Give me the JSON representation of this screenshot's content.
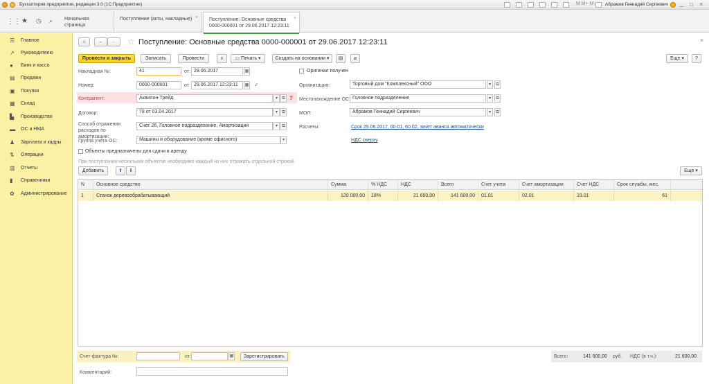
{
  "titlebar": {
    "title": "Бухгалтерия предприятия, редакция 3.0  (1С:Предприятие)",
    "user": "Абрамов Геннадий Сергеевич"
  },
  "tabs": [
    {
      "label": "Начальная страница"
    },
    {
      "label": "Поступление (акты, накладные)"
    },
    {
      "label": "Поступление: Основные средства 0000-000001 от 29.06.2017 12:23:11"
    }
  ],
  "sidebar": {
    "items": [
      {
        "label": "Главное",
        "icon": "menu-icon"
      },
      {
        "label": "Руководителю",
        "icon": "chart-line-icon"
      },
      {
        "label": "Банк и касса",
        "icon": "coin-icon"
      },
      {
        "label": "Продажи",
        "icon": "cart-icon"
      },
      {
        "label": "Покупки",
        "icon": "basket-icon"
      },
      {
        "label": "Склад",
        "icon": "warehouse-icon"
      },
      {
        "label": "Производство",
        "icon": "factory-icon"
      },
      {
        "label": "ОС и НМА",
        "icon": "truck-icon"
      },
      {
        "label": "Зарплата и кадры",
        "icon": "people-icon"
      },
      {
        "label": "Операции",
        "icon": "operations-icon"
      },
      {
        "label": "Отчеты",
        "icon": "bar-chart-icon"
      },
      {
        "label": "Справочники",
        "icon": "book-icon"
      },
      {
        "label": "Администрирование",
        "icon": "gear-icon"
      }
    ]
  },
  "doc": {
    "title": "Поступление: Основные средства 0000-000001 от 29.06.2017 12:23:11"
  },
  "toolbar": {
    "post_close": "Провести и закрыть",
    "save": "Записать",
    "post": "Провести",
    "print": "Печать",
    "create_based": "Создать на основании",
    "more": "Еще",
    "help": "?"
  },
  "form": {
    "invoice_label": "Накладная №:",
    "invoice_no": "41",
    "invoice_date_label": "от:",
    "invoice_date": "29.06.2017",
    "number_label": "Номер:",
    "number": "0000-000001",
    "number_date_label": "от:",
    "number_date": "29.06.2017 12:23:11",
    "original_label": "Оригинал получен",
    "org_label": "Организация:",
    "org": "Торговый дом \"Комплексный\" ООО",
    "counterparty_label": "Контрагент:",
    "counterparty": "Аквилон-Трейд",
    "location_label": "Местонахождение ОС:",
    "location": "Головное подразделение",
    "contract_label": "Договор:",
    "contract": "78 от 03.04.2017",
    "mol_label": "МОЛ:",
    "mol": "Абрамов Геннадий Сергеевич",
    "amort_label": "Способ отражения расходов по амортизации:",
    "amort": "Счет 26, Головное подразделение, Амортизация",
    "settlements_label": "Расчеты:",
    "settlements_link": "Срок 29.06.2017, 60.01, 60.02, зачет аванса автоматически",
    "group_label": "Группа учета ОС:",
    "group": "Машины и оборудование (кроме офисного)",
    "vat_link": "НДС сверху",
    "rent_label": "Объекты предназначены для сдачи в аренду",
    "hint": "При поступлении нескольких объектов необходимо каждый из них отражать отдельной строкой"
  },
  "table": {
    "add": "Добавить",
    "more": "Еще",
    "headers": [
      "N",
      "Основное средство",
      "Сумма",
      "% НДС",
      "НДС",
      "Всего",
      "Счет учета",
      "Счет амортизации",
      "Счет НДС",
      "Срок службы, мес."
    ],
    "rows": [
      [
        "1",
        "Станок деревообрабатывающий",
        "120 000,00",
        "18%",
        "21 600,00",
        "141 600,00",
        "01.01",
        "02.01",
        "19.01",
        "61"
      ]
    ]
  },
  "footer": {
    "sf_label": "Счет-фактура №:",
    "sf_date_label": "от:",
    "sf_date": ". .",
    "register": "Зарегистрировать",
    "comment_label": "Комментарий:",
    "total_label": "Всего:",
    "total": "141 600,00",
    "currency": "руб.",
    "vat_label": "НДС (в т.ч.):",
    "vat": "21 600,00"
  }
}
